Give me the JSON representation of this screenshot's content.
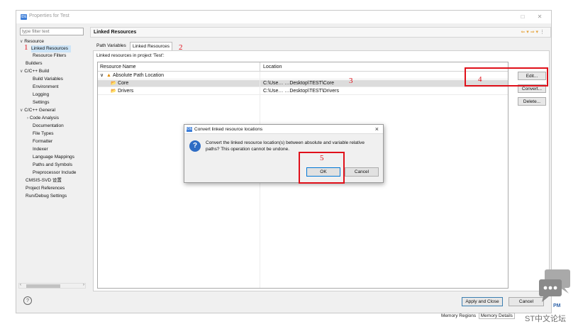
{
  "window": {
    "title": "Properties for Test",
    "filter_placeholder": "type filter text"
  },
  "tree": [
    {
      "label": "Resource",
      "arrow": "∨"
    },
    {
      "label": "Linked Resources",
      "selected": true
    },
    {
      "label": "Resource Filters"
    },
    {
      "label": "Builders"
    },
    {
      "label": "C/C++ Build",
      "arrow": "∨"
    },
    {
      "label": "Build Variables"
    },
    {
      "label": "Environment"
    },
    {
      "label": "Logging"
    },
    {
      "label": "Settings"
    },
    {
      "label": "C/C++ General",
      "arrow": "∨"
    },
    {
      "label": "Code Analysis",
      "arrow": "›"
    },
    {
      "label": "Documentation"
    },
    {
      "label": "File Types"
    },
    {
      "label": "Formatter"
    },
    {
      "label": "Indexer"
    },
    {
      "label": "Language Mappings"
    },
    {
      "label": "Paths and Symbols"
    },
    {
      "label": "Preprocessor Include"
    },
    {
      "label": "CMSIS-SVD 设置"
    },
    {
      "label": "Project References"
    },
    {
      "label": "Run/Debug Settings"
    }
  ],
  "page": {
    "header": "Linked Resources",
    "tabs": [
      "Path Variables",
      "Linked Resources"
    ],
    "subtitle": "Linked resources in project 'Test':",
    "columns": [
      "Resource Name",
      "Location"
    ],
    "rows": [
      {
        "name": "Absolute Path Location",
        "location": ""
      },
      {
        "name": "Core",
        "location": "C:\\Use…  …Desktop\\TEST\\Core"
      },
      {
        "name": "Drivers",
        "location": "C:\\Use…  …Desktop\\TEST\\Drivers"
      }
    ],
    "buttons": {
      "edit": "Edit...",
      "convert": "Convert...",
      "delete": "Delete..."
    }
  },
  "footer": {
    "apply_close": "Apply and Close",
    "cancel": "Cancel",
    "help": "?"
  },
  "dialog": {
    "title": "Convert linked resource locations",
    "message": "Convert the linked resource location(s) between absolute and variable relative paths?  This operation cannot be undone.",
    "ok": "OK",
    "cancel": "Cancel"
  },
  "annotations": [
    "1",
    "2",
    "3",
    "4",
    "5"
  ],
  "background": {
    "tabs": [
      "Memory Regions",
      "Memory Details"
    ],
    "watermark": "ST中文论坛",
    "pm": "PM"
  },
  "colors": {
    "annotation_red": "#e0101a",
    "selection": "#cce4f7",
    "accent_blue": "#3b7dd8"
  }
}
